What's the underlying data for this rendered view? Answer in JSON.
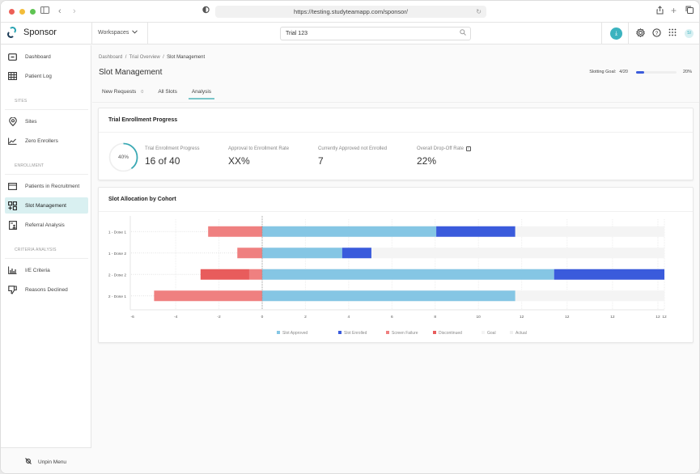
{
  "browser": {
    "url": "https://testing.studyteamapp.com/sponsor/",
    "icons": [
      "sidebar-toggle-icon",
      "back-icon",
      "forward-icon",
      "shield-icon",
      "reload-icon",
      "share-icon",
      "new-tab-icon",
      "tabs-icon"
    ]
  },
  "header": {
    "brand": "Sponsor",
    "workspaces_label": "Workspaces",
    "search_value": "Trial 123",
    "avatar_initials": "SI"
  },
  "sidebar": {
    "items": [
      {
        "label": "Dashboard",
        "icon": "dashboard-icon"
      },
      {
        "label": "Patient Log",
        "icon": "table-icon"
      },
      {
        "label": "Sites",
        "icon": "location-pin-icon"
      },
      {
        "label": "Zero Enrollers",
        "icon": "line-chart-icon"
      },
      {
        "label": "Patients in Recruitment",
        "icon": "window-icon"
      },
      {
        "label": "Slot Management",
        "icon": "grid-add-icon",
        "active": true
      },
      {
        "label": "Referral Analysis",
        "icon": "report-user-icon"
      },
      {
        "label": "I/E Criteria",
        "icon": "bar-chart-icon"
      },
      {
        "label": "Reasons Declined",
        "icon": "thumbs-down-icon"
      }
    ],
    "sections": [
      "SITES",
      "ENROLLMENT",
      "CRITERIA ANALYSIS"
    ],
    "unpin_label": "Unpin Menu"
  },
  "main": {
    "breadcrumb": [
      "Dashboard",
      "Trial Overview",
      "Slot Management"
    ],
    "title": "Slot Management",
    "slotting_goal": {
      "label": "Slotting Goal:",
      "value": "4/20",
      "percent_label": "20%",
      "fraction": 0.2
    },
    "tabs": [
      {
        "label": "New Requests",
        "count": "0"
      },
      {
        "label": "All Slots"
      },
      {
        "label": "Analysis",
        "active": true
      }
    ]
  },
  "enrollment_card": {
    "title": "Trial Enrollment Progress",
    "ring_label": "40%",
    "ring_fraction": 0.4,
    "stats": [
      {
        "label": "Trial Enrollment Progress",
        "value": "16 of 40"
      },
      {
        "label": "Approval to Enrollment Rate",
        "value": "XX%"
      },
      {
        "label": "Currently Approved not Enrolled",
        "value": "7"
      },
      {
        "label": "Overall Drop-Off Rate",
        "value": "22%",
        "info": true
      }
    ]
  },
  "chart_card": {
    "title": "Slot Allocation by Cohort"
  },
  "chart_data": {
    "type": "bar",
    "orientation": "horizontal",
    "stacked": true,
    "title": "Slot Allocation by Cohort",
    "categories": [
      "1 - Dose 1",
      "1 - Dose 2",
      "2 - Dose 2",
      "2 - Dose 1"
    ],
    "series": [
      {
        "name": "Slot Approved",
        "color": "#85c6e4",
        "values": [
          8.05,
          3.7,
          13.5,
          11.7
        ]
      },
      {
        "name": "Slot Enrolled",
        "color": "#3a5bdc",
        "values": [
          3.65,
          1.35,
          5.1,
          0
        ]
      },
      {
        "name": "Screen Failure",
        "color": "#ef8080",
        "values": [
          -2.5,
          -1.15,
          -0.6,
          -5.0
        ]
      },
      {
        "name": "Discontinued",
        "color": "#e85c5c",
        "values": [
          0,
          0,
          -2.25,
          0
        ]
      },
      {
        "name": "Goal",
        "color": "#f4f4f4",
        "values": [
          18.6,
          18.6,
          18.6,
          18.6
        ]
      },
      {
        "name": "Actual",
        "color": "#efefef",
        "values": [
          null,
          null,
          null,
          null
        ]
      }
    ],
    "xlim": [
      -6.1,
      18.6
    ],
    "xticks": [
      "-6",
      "-4",
      "-2",
      "0",
      "2",
      "4",
      "6",
      "8",
      "10",
      "12",
      "12",
      "12",
      "12",
      "12"
    ],
    "xtick_values": [
      -6,
      -4,
      -2,
      0,
      2,
      4,
      6,
      8,
      10,
      12,
      14.1,
      16.2,
      18.3,
      18.6
    ],
    "legend": [
      "Slot Approved",
      "Slot Enrolled",
      "Screen Failure",
      "Discontinued",
      "Goal",
      "Actual"
    ],
    "legend_position": "bottom",
    "grid": true,
    "xlabel": "",
    "ylabel": ""
  }
}
